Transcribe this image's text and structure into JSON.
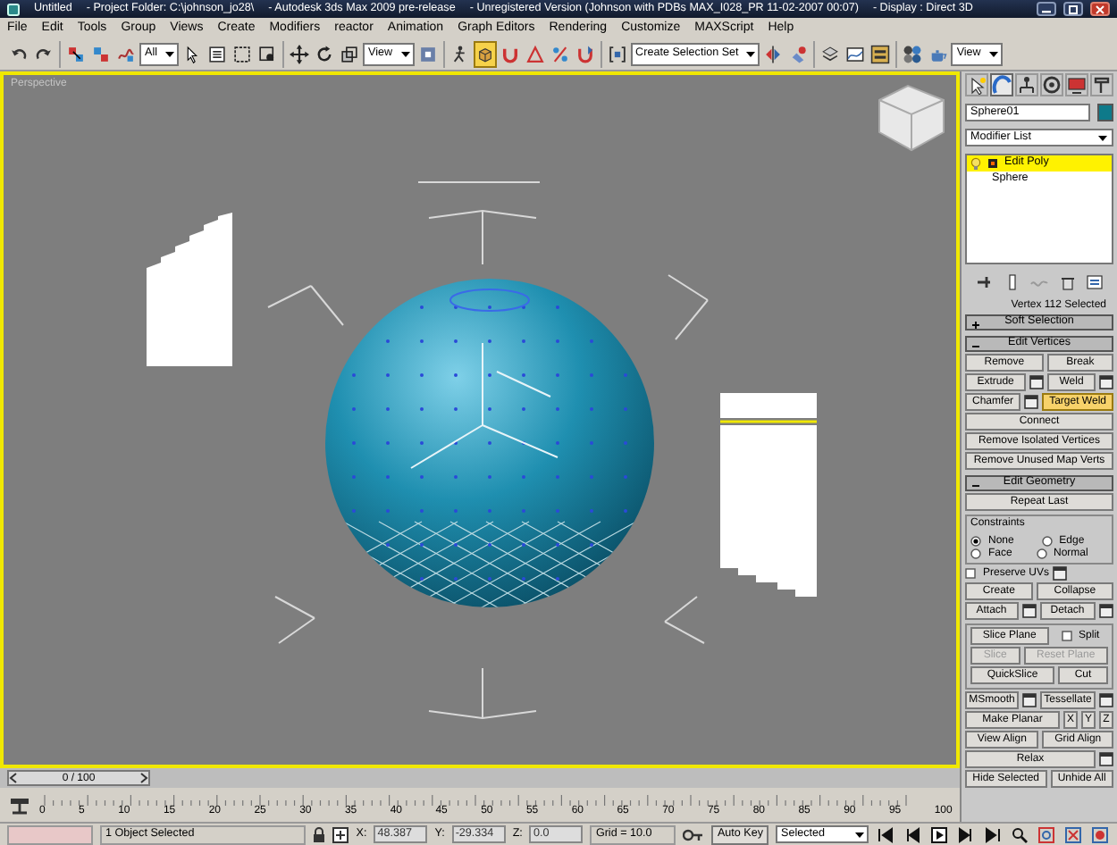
{
  "window": {
    "title_parts": [
      "Untitled",
      "- Project Folder: C:\\johnson_jo28\\",
      "- Autodesk 3ds Max 2009 pre-release",
      "- Unregistered Version (Johnson with PDBs MAX_I028_PR 11-02-2007 00:07)",
      "- Display : Direct 3D"
    ]
  },
  "menu": [
    "File",
    "Edit",
    "Tools",
    "Group",
    "Views",
    "Create",
    "Modifiers",
    "reactor",
    "Animation",
    "Graph Editors",
    "Rendering",
    "Customize",
    "MAXScript",
    "Help"
  ],
  "toolbar": [
    {
      "kind": "icon",
      "selected": false
    },
    {
      "kind": "icon",
      "selected": false
    },
    {
      "kind": "separator"
    },
    {
      "kind": "icon",
      "selected": false
    },
    {
      "kind": "icon",
      "selected": false
    },
    {
      "kind": "icon",
      "selected": false
    },
    {
      "kind": "dropdown",
      "value": "All"
    },
    {
      "kind": "icon",
      "selected": false
    },
    {
      "kind": "icon",
      "selected": false
    },
    {
      "kind": "icon",
      "selected": false
    },
    {
      "kind": "icon",
      "selected": false
    },
    {
      "kind": "separator"
    },
    {
      "kind": "icon",
      "selected": false
    },
    {
      "kind": "icon",
      "selected": false
    },
    {
      "kind": "icon",
      "selected": false
    },
    {
      "kind": "dropdown",
      "value": "View"
    },
    {
      "kind": "icon",
      "selected": false
    },
    {
      "kind": "separator"
    },
    {
      "kind": "icon",
      "selected": false
    },
    {
      "kind": "icon",
      "selected": true
    },
    {
      "kind": "icon",
      "selected": false
    },
    {
      "kind": "icon",
      "selected": false
    },
    {
      "kind": "icon",
      "selected": false
    },
    {
      "kind": "icon",
      "selected": false
    },
    {
      "kind": "separator"
    },
    {
      "kind": "icon",
      "selected": false
    },
    {
      "kind": "dropdown",
      "value": "Create Selection Set"
    },
    {
      "kind": "icon",
      "selected": false
    },
    {
      "kind": "icon",
      "selected": false
    },
    {
      "kind": "separator"
    },
    {
      "kind": "icon",
      "selected": false
    },
    {
      "kind": "icon",
      "selected": false
    },
    {
      "kind": "icon",
      "selected": false
    },
    {
      "kind": "separator"
    },
    {
      "kind": "icon",
      "selected": false
    },
    {
      "kind": "icon",
      "selected": false
    },
    {
      "kind": "dropdown",
      "value": "View"
    }
  ],
  "viewport": {
    "label": "Perspective",
    "active": true
  },
  "command_panel": {
    "tabs": [
      {
        "selected": false
      },
      {
        "selected": true
      },
      {
        "selected": false
      },
      {
        "selected": false
      },
      {
        "selected": false
      },
      {
        "selected": false
      }
    ],
    "object_name": "Sphere01",
    "modifier_list": "Modifier List",
    "stack": [
      {
        "label": "Edit Poly",
        "selected": true
      },
      {
        "label": "Sphere",
        "selected": false
      }
    ],
    "selection_info": "Vertex 112 Selected",
    "rollouts": [
      {
        "title": "Soft Selection",
        "expanded": false
      },
      {
        "title": "Edit Vertices",
        "expanded": true,
        "content": [
          {
            "kind": "row",
            "items": [
              {
                "kind": "button",
                "label": "Remove",
                "settings": false,
                "selected": false,
                "disabled": false
              },
              {
                "kind": "button",
                "label": "Break",
                "settings": false,
                "selected": false,
                "disabled": false
              }
            ]
          },
          {
            "kind": "row",
            "items": [
              {
                "kind": "button",
                "label": "Extrude",
                "settings": true,
                "selected": false,
                "disabled": false
              },
              {
                "kind": "button",
                "label": "Weld",
                "settings": true,
                "selected": false,
                "disabled": false
              }
            ]
          },
          {
            "kind": "row",
            "items": [
              {
                "kind": "button",
                "label": "Chamfer",
                "settings": true,
                "selected": false,
                "disabled": false
              },
              {
                "kind": "button",
                "label": "Target Weld",
                "settings": false,
                "selected": true,
                "disabled": false
              }
            ]
          },
          {
            "kind": "row",
            "items": [
              {
                "kind": "button",
                "label": "Connect",
                "settings": false,
                "selected": false,
                "disabled": false
              }
            ]
          },
          {
            "kind": "row",
            "items": [
              {
                "kind": "button",
                "label": "Remove Isolated Vertices",
                "settings": false,
                "selected": false,
                "disabled": false
              }
            ]
          },
          {
            "kind": "row",
            "items": [
              {
                "kind": "button",
                "label": "Remove Unused Map Verts",
                "settings": false,
                "selected": false,
                "disabled": false
              }
            ]
          }
        ]
      },
      {
        "title": "Edit Geometry",
        "expanded": true,
        "content": [
          {
            "kind": "row",
            "items": [
              {
                "kind": "button",
                "label": "Repeat Last",
                "settings": false,
                "selected": false,
                "disabled": false
              }
            ]
          },
          {
            "kind": "group",
            "title": "Constraints",
            "rows": [
              [
                {
                  "kind": "radio",
                  "label": "None",
                  "selected": true
                },
                {
                  "kind": "radio",
                  "label": "Edge",
                  "selected": false
                }
              ],
              [
                {
                  "kind": "radio",
                  "label": "Face",
                  "selected": false
                },
                {
                  "kind": "radio",
                  "label": "Normal",
                  "selected": false
                }
              ]
            ]
          },
          {
            "kind": "row",
            "items": [
              {
                "kind": "checkbox",
                "label": "Preserve UVs",
                "checked": false,
                "settings": true
              }
            ]
          },
          {
            "kind": "row",
            "items": [
              {
                "kind": "button",
                "label": "Create",
                "settings": false,
                "selected": false,
                "disabled": false
              },
              {
                "kind": "button",
                "label": "Collapse",
                "settings": false,
                "selected": false,
                "disabled": false
              }
            ]
          },
          {
            "kind": "row",
            "items": [
              {
                "kind": "button",
                "label": "Attach",
                "settings": true,
                "selected": false,
                "disabled": false
              },
              {
                "kind": "button",
                "label": "Detach",
                "settings": true,
                "selected": false,
                "disabled": false
              }
            ]
          },
          {
            "kind": "group",
            "rows": [
              [
                {
                  "kind": "button",
                  "label": "Slice Plane",
                  "settings": false,
                  "selected": false,
                  "disabled": false
                },
                {
                  "kind": "checkbox",
                  "label": "Split",
                  "checked": false,
                  "settings": false
                }
              ],
              [
                {
                  "kind": "button",
                  "label": "Slice",
                  "settings": false,
                  "selected": false,
                  "disabled": true
                },
                {
                  "kind": "button",
                  "label": "Reset Plane",
                  "settings": false,
                  "selected": false,
                  "disabled": true
                }
              ],
              [
                {
                  "kind": "button",
                  "label": "QuickSlice",
                  "settings": false,
                  "selected": false,
                  "disabled": false
                },
                {
                  "kind": "button",
                  "label": "Cut",
                  "settings": false,
                  "selected": false,
                  "disabled": false
                }
              ]
            ]
          },
          {
            "kind": "row",
            "items": [
              {
                "kind": "button",
                "label": "MSmooth",
                "settings": true,
                "selected": false,
                "disabled": false
              },
              {
                "kind": "button",
                "label": "Tessellate",
                "settings": true,
                "selected": false,
                "disabled": false
              }
            ]
          },
          {
            "kind": "row",
            "items": [
              {
                "kind": "button",
                "label": "Make Planar",
                "settings": false,
                "selected": false,
                "disabled": false
              },
              {
                "kind": "axis",
                "label": "X"
              },
              {
                "kind": "axis",
                "label": "Y"
              },
              {
                "kind": "axis",
                "label": "Z"
              }
            ]
          },
          {
            "kind": "row",
            "items": [
              {
                "kind": "button",
                "label": "View Align",
                "settings": false,
                "selected": false,
                "disabled": false
              },
              {
                "kind": "button",
                "label": "Grid Align",
                "settings": false,
                "selected": false,
                "disabled": false
              }
            ]
          },
          {
            "kind": "row",
            "items": [
              {
                "kind": "button",
                "label": "Relax",
                "settings": true,
                "selected": false,
                "disabled": false
              }
            ]
          },
          {
            "kind": "row",
            "items": [
              {
                "kind": "button",
                "label": "Hide Selected",
                "settings": false,
                "selected": false,
                "disabled": false
              },
              {
                "kind": "button",
                "label": "Unhide All",
                "settings": false,
                "selected": false,
                "disabled": false
              }
            ]
          }
        ]
      }
    ]
  },
  "time_slider": {
    "label": "0 / 100",
    "level": 0
  },
  "ruler_labels": [
    "0",
    "5",
    "10",
    "15",
    "20",
    "25",
    "30",
    "35",
    "40",
    "45",
    "50",
    "55",
    "60",
    "65",
    "70",
    "75",
    "80",
    "85",
    "90",
    "95",
    "100"
  ],
  "status_bar": {
    "prompt": "1 Object Selected",
    "coords": [
      {
        "axis": "X:",
        "value": "48.387"
      },
      {
        "axis": "Y:",
        "value": "-29.334"
      },
      {
        "axis": "Z:",
        "value": "0.0"
      }
    ],
    "grid": "Grid = 10.0",
    "auto_key": "Auto Key",
    "key_filter": "Selected"
  }
}
